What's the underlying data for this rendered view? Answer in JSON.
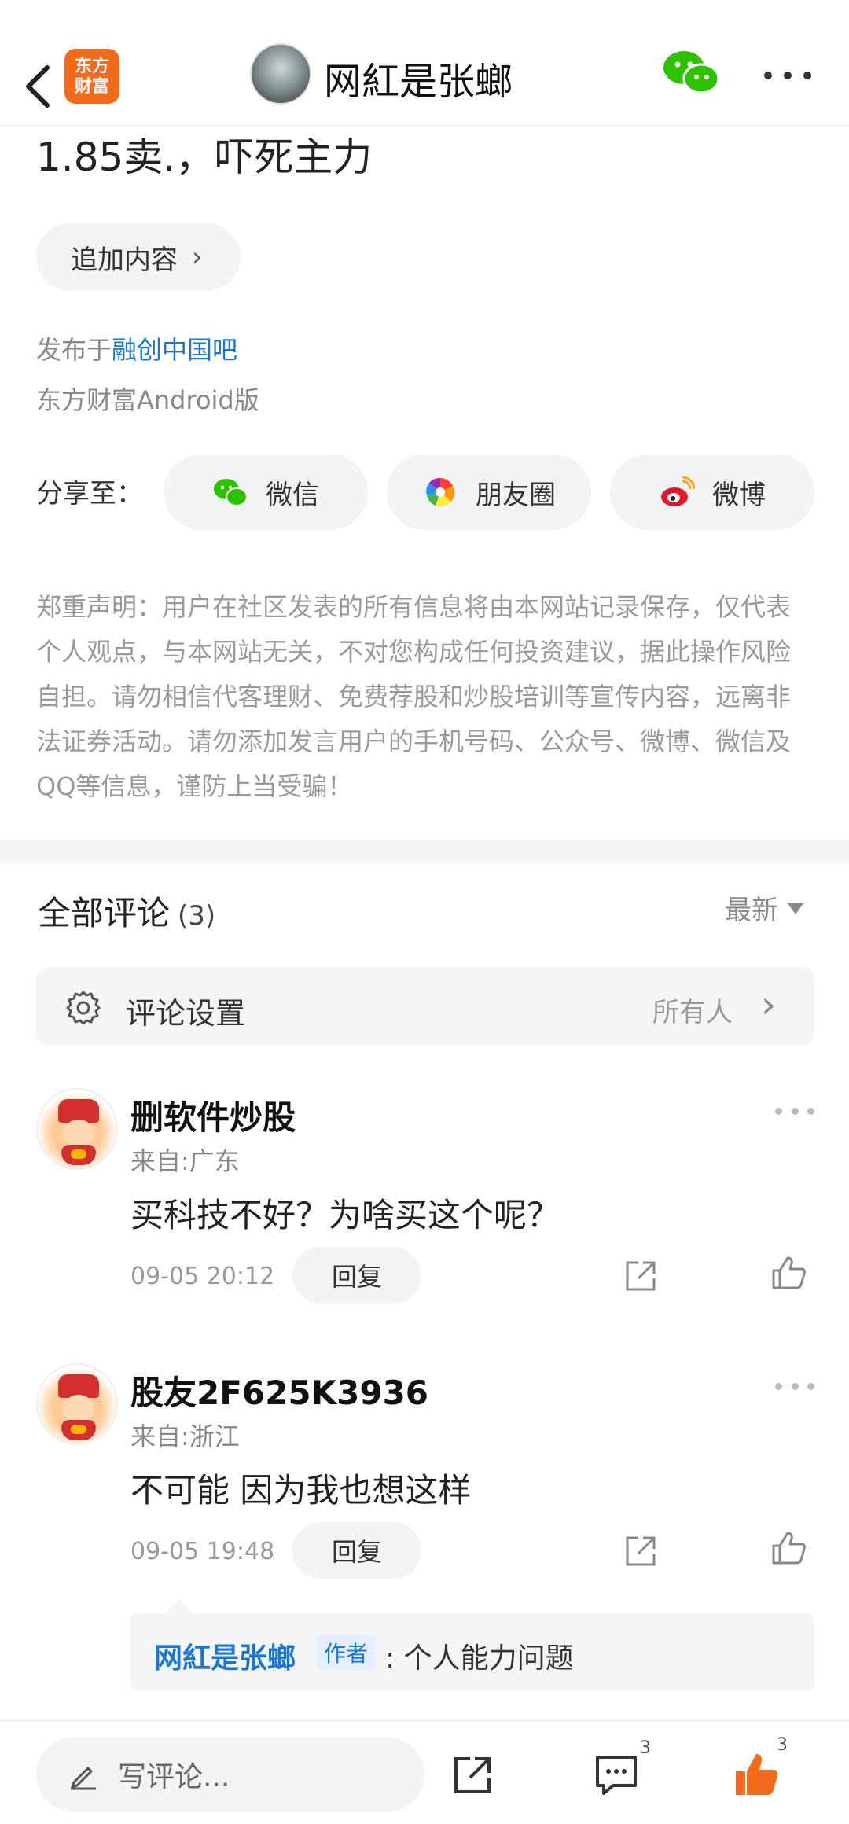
{
  "header": {
    "brand_logo_text_line1": "东方",
    "brand_logo_text_line2": "财富",
    "title": "网紅是张螂"
  },
  "post": {
    "text": "1.85卖.，吓死主力",
    "add_content_label": "追加内容",
    "published_prefix": "发布于",
    "published_link": "融创中国吧",
    "platform": "东方财富Android版"
  },
  "share": {
    "label": "分享至：",
    "options": [
      {
        "label": "微信",
        "icon": "wechat-icon"
      },
      {
        "label": "朋友圈",
        "icon": "moments-icon"
      },
      {
        "label": "微博",
        "icon": "weibo-icon"
      }
    ]
  },
  "disclaimer": "郑重声明：用户在社区发表的所有信息将由本网站记录保存，仅代表个人观点，与本网站无关，不对您构成任何投资建议，据此操作风险自担。请勿相信代客理财、免费荐股和炒股培训等宣传内容，远离非法证券活动。请勿添加发言用户的手机号码、公众号、微博、微信及QQ等信息，谨防上当受骗！",
  "comments": {
    "title": "全部评论",
    "count": "(3)",
    "sort_label": "最新",
    "settings_label": "评论设置",
    "settings_value": "所有人",
    "items": [
      {
        "name": "删软件炒股",
        "from": "来自:广东",
        "text": "买科技不好？为啥买这个呢？",
        "time": "09-05 20:12",
        "reply_label": "回复"
      },
      {
        "name": "股友2F625K3936",
        "from": "来自:浙江",
        "text": "不可能 因为我也想这样",
        "time": "09-05 19:48",
        "reply_label": "回复",
        "sub_reply": {
          "name": "网紅是张螂",
          "badge": "作者",
          "text": ": 个人能力问题"
        }
      }
    ]
  },
  "bottom_bar": {
    "write_placeholder": "写评论...",
    "comment_count": "3",
    "like_count": "3"
  },
  "colors": {
    "brand_orange": "#f26a1b",
    "link_blue": "#1976d2",
    "like_orange": "#f26a1b"
  }
}
